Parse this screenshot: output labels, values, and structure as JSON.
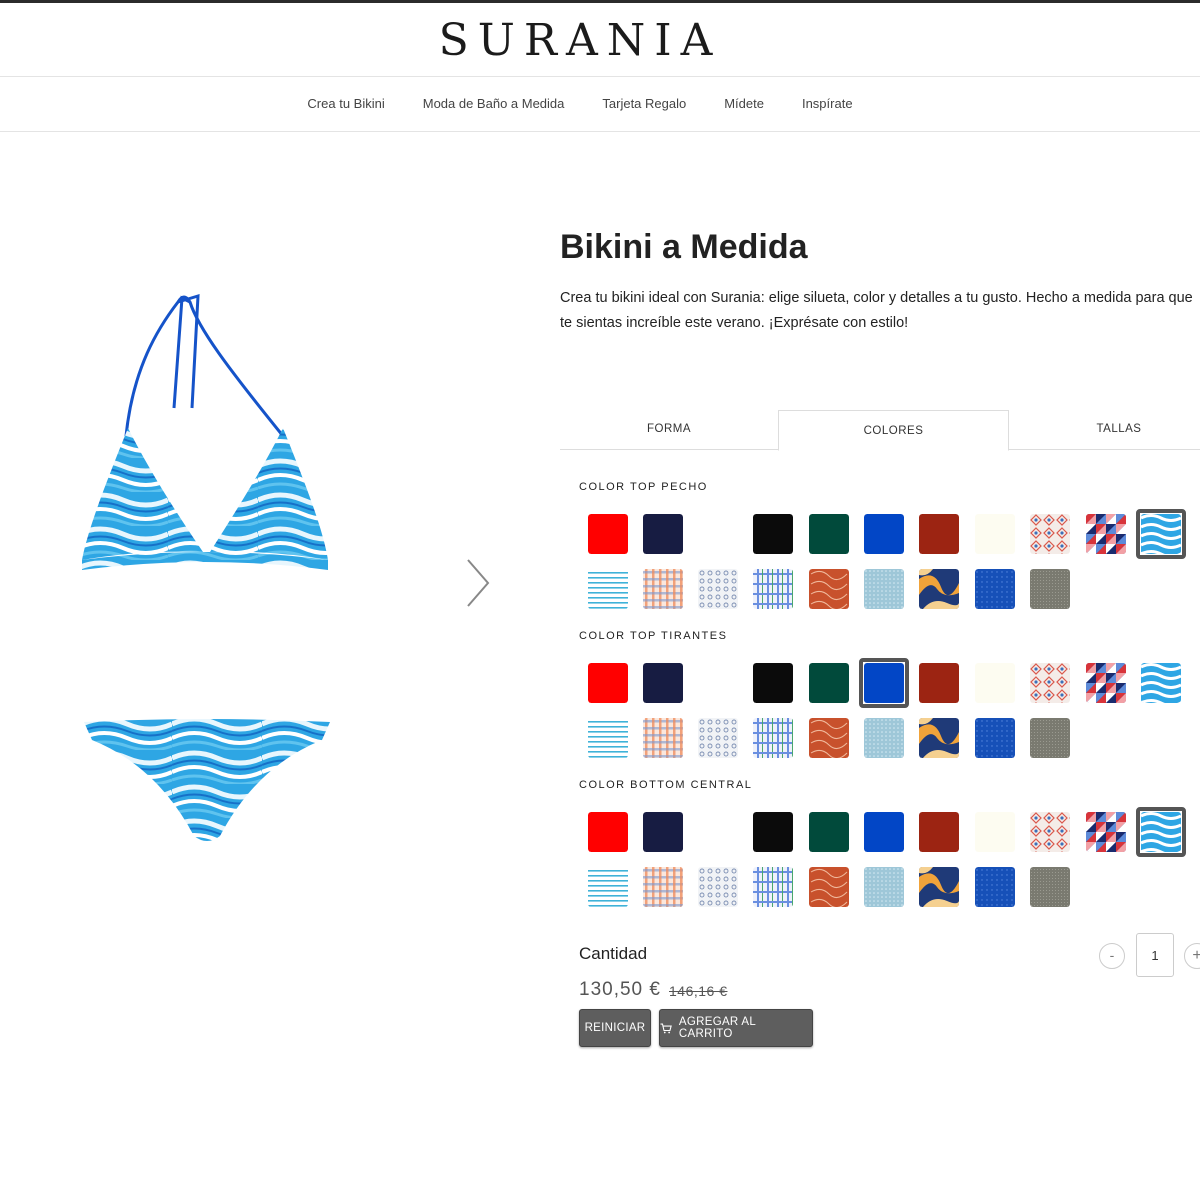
{
  "brand": "SURANIA",
  "nav": {
    "items": [
      "Crea tu Bikini",
      "Moda de Baño a Medida",
      "Tarjeta Regalo",
      "Mídete",
      "Inspírate"
    ]
  },
  "product": {
    "title": "Bikini a Medida",
    "description_line1": "Crea tu bikini ideal con Surania: elige silueta, color y detalles a tu gusto. Hecho a medida para que",
    "description_line2": "te sientas increíble este verano. ¡Exprésate con estilo!"
  },
  "tabs": [
    "FORMA",
    "COLORES",
    "TALLAS"
  ],
  "active_tab": "COLORES",
  "sections": [
    {
      "label": "COLOR TOP PECHO",
      "selected": "waves-blue"
    },
    {
      "label": "COLOR TOP TIRANTES",
      "selected": "royal-blue"
    },
    {
      "label": "COLOR BOTTOM CENTRAL",
      "selected": "waves-blue"
    }
  ],
  "swatches_row1": [
    "red",
    "navy",
    "white",
    "black",
    "dark-green",
    "royal-blue",
    "rust-red",
    "ivory",
    "tile-pattern",
    "geometric-pattern",
    "waves-blue"
  ],
  "swatches_row2": [
    "blue-stripes",
    "orange-plaid",
    "blue-floral-print",
    "blue-green-check",
    "orange-leaf-print",
    "light-blue-texture",
    "orange-blue-abstract",
    "blue-dotted-texture",
    "gray-texture"
  ],
  "colors": {
    "red": "#ff0000",
    "navy": "#171c42",
    "white": "#ffffff",
    "black": "#0b0b0b",
    "dark-green": "#014a3b",
    "royal-blue": "#0246c6",
    "rust-red": "#9c2412",
    "ivory": "#fdfcf1",
    "gray-texture": "#7a7a70",
    "button": "#5e5e5e"
  },
  "quantity": {
    "label": "Cantidad",
    "value": "1",
    "minus": "-",
    "plus": "+"
  },
  "price": {
    "current": "130,50 €",
    "old": "146,16 €"
  },
  "buttons": {
    "reset": "REINICIAR",
    "add_to_cart": "AGREGAR AL CARRITO"
  }
}
